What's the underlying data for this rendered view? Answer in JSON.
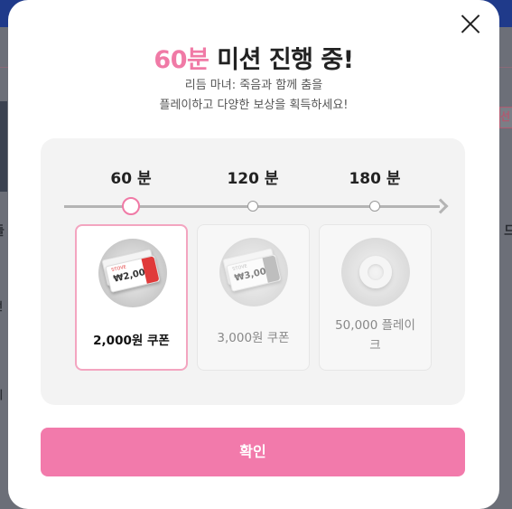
{
  "modal": {
    "title_highlight": "60분",
    "title_rest": " 미션 진행 중!",
    "subtitle_line1": "리듬 마녀: 죽음과 함께 춤을",
    "subtitle_line2": "플레이하고 다양한 보상을 획득하세요!",
    "confirm_label": "확인"
  },
  "progress": {
    "milestones": [
      {
        "time": "60 분",
        "active": true
      },
      {
        "time": "120 분",
        "active": false
      },
      {
        "time": "180 분",
        "active": false
      }
    ],
    "accent_color": "#f07aa6"
  },
  "rewards": [
    {
      "label": "2,000원 쿠폰",
      "ticket_amount": "₩2,000",
      "icon": "coupon-icon",
      "active": true
    },
    {
      "label": "3,000원 쿠폰",
      "ticket_amount": "₩3,000",
      "icon": "coupon-icon",
      "active": false
    },
    {
      "label": "50,000 플레이",
      "label_line2": "크",
      "icon": "donut-icon",
      "active": false
    }
  ],
  "backdrop": {
    "glyph_right_1": "선",
    "glyph_right_2": "드",
    "glyph_left_1": "들",
    "glyph_left_2": "전",
    "glyph_left_3": "세"
  },
  "colors": {
    "brand_pink": "#f27aab",
    "active_border": "#f3a5c0",
    "header_blue": "#1f3a8a"
  }
}
